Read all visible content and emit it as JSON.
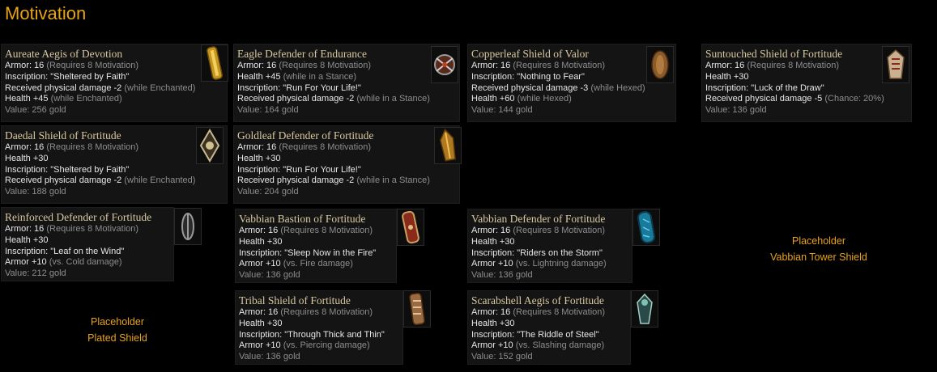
{
  "page_title": "Motivation",
  "items": [
    {
      "name": "Aureate Aegis of Devotion",
      "armor": "Armor: 16",
      "req": " (Requires 8 Motivation)",
      "lines": [
        {
          "w": "Inscription: \"Sheltered by Faith\"",
          "g": ""
        },
        {
          "w": "Received physical damage -2",
          "g": " (while Enchanted)"
        },
        {
          "w": "Health +45",
          "g": " (while Enchanted)"
        }
      ],
      "value": "Value: 256 gold",
      "icon": "aureate-shield-icon"
    },
    {
      "name": "Eagle Defender of Endurance",
      "armor": "Armor: 16",
      "req": " (Requires 8 Motivation)",
      "lines": [
        {
          "w": "Health +45",
          "g": " (while in a Stance)"
        },
        {
          "w": "Inscription: \"Run For Your Life!\"",
          "g": ""
        },
        {
          "w": "Received physical damage -2",
          "g": " (while in a Stance)"
        }
      ],
      "value": "Value: 164 gold",
      "icon": "eagle-shield-icon"
    },
    {
      "name": "Copperleaf Shield of Valor",
      "armor": "Armor: 16",
      "req": " (Requires 8 Motivation)",
      "lines": [
        {
          "w": "Inscription: \"Nothing to Fear\"",
          "g": ""
        },
        {
          "w": "Received physical damage -3",
          "g": " (while Hexed)"
        },
        {
          "w": "Health +60",
          "g": " (while Hexed)"
        }
      ],
      "value": "Value: 144 gold",
      "icon": "copperleaf-shield-icon"
    },
    {
      "name": "Suntouched Shield of Fortitude",
      "armor": "Armor: 16",
      "req": " (Requires 8 Motivation)",
      "lines": [
        {
          "w": "Health +30",
          "g": ""
        },
        {
          "w": "Inscription: \"Luck of the Draw\"",
          "g": ""
        },
        {
          "w": "Received physical damage -5",
          "g": " (Chance: 20%)"
        }
      ],
      "value": "Value: 136 gold",
      "icon": "suntouched-shield-icon"
    },
    {
      "name": "Daedal Shield of Fortitude",
      "armor": "Armor: 16",
      "req": " (Requires 8 Motivation)",
      "lines": [
        {
          "w": "Health +30",
          "g": ""
        },
        {
          "w": "Inscription: \"Sheltered by Faith\"",
          "g": ""
        },
        {
          "w": "Received physical damage -2",
          "g": " (while Enchanted)"
        }
      ],
      "value": "Value: 188 gold",
      "icon": "daedal-shield-icon"
    },
    {
      "name": "Goldleaf Defender of Fortitude",
      "armor": "Armor: 16",
      "req": " (Requires 8 Motivation)",
      "lines": [
        {
          "w": "Health +30",
          "g": ""
        },
        {
          "w": "Inscription: \"Run For Your Life!\"",
          "g": ""
        },
        {
          "w": "Received physical damage -2",
          "g": " (while in a Stance)"
        }
      ],
      "value": "Value: 204 gold",
      "icon": "goldleaf-shield-icon"
    },
    {
      "name": "Reinforced Defender of Fortitude",
      "armor": "Armor: 16",
      "req": " (Requires 8 Motivation)",
      "lines": [
        {
          "w": "Health +30",
          "g": ""
        },
        {
          "w": "Inscription: \"Leaf on the Wind\"",
          "g": ""
        },
        {
          "w": "Armor +10",
          "g": " (vs. Cold damage)"
        }
      ],
      "value": "Value: 212 gold",
      "icon": "reinforced-shield-icon"
    },
    {
      "name": "Vabbian Bastion of Fortitude",
      "armor": "Armor: 16",
      "req": " (Requires 8 Motivation)",
      "lines": [
        {
          "w": "Health +30",
          "g": ""
        },
        {
          "w": "Inscription: \"Sleep Now in the Fire\"",
          "g": ""
        },
        {
          "w": "Armor +10",
          "g": " (vs. Fire damage)"
        }
      ],
      "value": "Value: 136 gold",
      "icon": "vabbian-bastion-icon"
    },
    {
      "name": "Vabbian Defender of Fortitude",
      "armor": "Armor: 16",
      "req": " (Requires 8 Motivation)",
      "lines": [
        {
          "w": "Health +30",
          "g": ""
        },
        {
          "w": "Inscription: \"Riders on the Storm\"",
          "g": ""
        },
        {
          "w": "Armor +10",
          "g": " (vs. Lightning damage)"
        }
      ],
      "value": "Value: 136 gold",
      "icon": "vabbian-defender-icon"
    },
    {
      "name": "Tribal Shield of Fortitude",
      "armor": "Armor: 16",
      "req": " (Requires 8 Motivation)",
      "lines": [
        {
          "w": "Health +30",
          "g": ""
        },
        {
          "w": "Inscription: \"Through Thick and Thin\"",
          "g": ""
        },
        {
          "w": "Armor +10",
          "g": " (vs. Piercing damage)"
        }
      ],
      "value": "Value: 136 gold",
      "icon": "tribal-shield-icon"
    },
    {
      "name": "Scarabshell Aegis of Fortitude",
      "armor": "Armor: 16",
      "req": " (Requires 8 Motivation)",
      "lines": [
        {
          "w": "Health +30",
          "g": ""
        },
        {
          "w": "Inscription: \"The Riddle of Steel\"",
          "g": ""
        },
        {
          "w": "Armor +10",
          "g": " (vs. Slashing damage)"
        }
      ],
      "value": "Value: 152 gold",
      "icon": "scarabshell-shield-icon"
    }
  ],
  "placeholders": [
    {
      "line1": "Placeholder",
      "line2": "Plated Shield"
    },
    {
      "line1": "Placeholder",
      "line2": "Vabbian Tower Shield"
    }
  ],
  "colors": {
    "title": "#e8a317",
    "stat_text": "#e6e6e6",
    "note_text": "#8d8d8d",
    "item_name": "#d8c8a0"
  }
}
